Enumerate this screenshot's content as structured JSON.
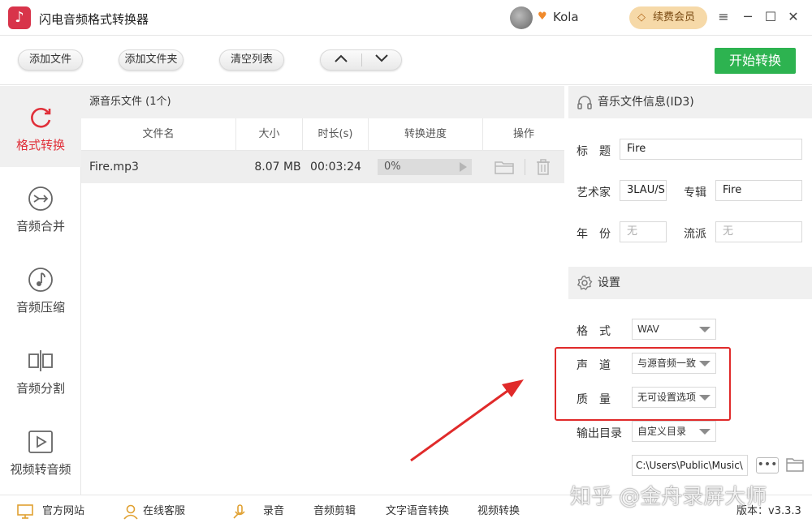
{
  "app": {
    "title": "闪电音频格式转换器",
    "username": "Kola",
    "renew_label": "续费会员",
    "accent_green": "#2db350",
    "accent_red": "#e0303a"
  },
  "toolbar": {
    "add_file": "添加文件",
    "add_folder": "添加文件夹",
    "clear_list": "清空列表",
    "start_convert": "开始转换"
  },
  "nav": [
    {
      "label": "格式转换",
      "icon": "refresh-icon",
      "active": true
    },
    {
      "label": "音频合并",
      "icon": "merge-icon"
    },
    {
      "label": "音频压缩",
      "icon": "music-note-icon"
    },
    {
      "label": "音频分割",
      "icon": "split-icon"
    },
    {
      "label": "视频转音频",
      "icon": "play-icon"
    }
  ],
  "file_list": {
    "header": "源音乐文件 (1个)",
    "columns": [
      "文件名",
      "大小",
      "时长(s)",
      "转换进度",
      "操作"
    ],
    "rows": [
      {
        "name": "Fire.mp3",
        "size": "8.07 MB",
        "duration": "00:03:24",
        "progress": "0%",
        "progress_fraction": 0
      }
    ]
  },
  "id3": {
    "section_title": "音乐文件信息(ID3)",
    "title_label": "标　题",
    "title_value": "Fire",
    "artist_label": "艺术家",
    "artist_value": "3LAU/S",
    "album_label": "专辑",
    "album_value": "Fire",
    "year_label": "年　份",
    "year_placeholder": "无",
    "genre_label": "流派",
    "genre_placeholder": "无"
  },
  "settings": {
    "section_title": "设置",
    "format_label": "格　式",
    "format_value": "WAV",
    "channel_label": "声　道",
    "channel_value": "与源音频一致",
    "quality_label": "质　量",
    "quality_value": "无可设置选项",
    "output_label": "输出目录",
    "output_value": "自定义目录",
    "output_path": "C:\\Users\\Public\\Music\\"
  },
  "statusbar": {
    "official_site": "官方网站",
    "online_service": "在线客服",
    "record": "录音",
    "audio_edit": "音频剪辑",
    "tts": "文字语音转换",
    "video_convert": "视频转换",
    "version": "版本：v3.3.3"
  },
  "watermark": "知乎 @金舟录屏大师"
}
